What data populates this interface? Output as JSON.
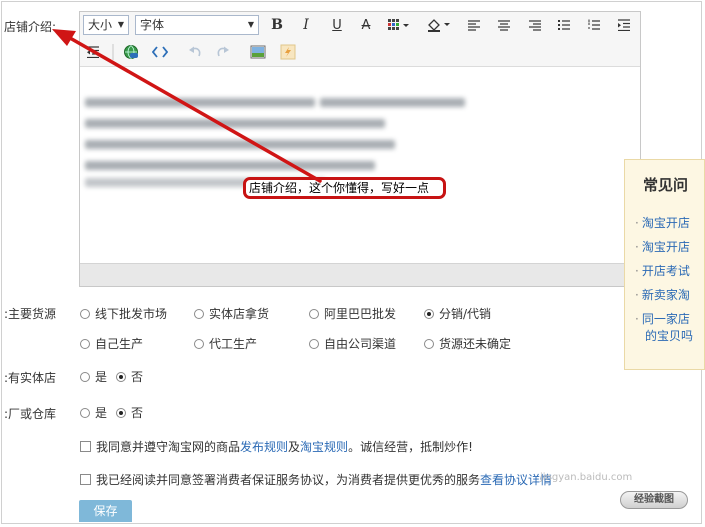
{
  "labels": {
    "shop_intro": "店铺介绍:",
    "main_source": "主要货源:",
    "has_store": "有实体店:",
    "has_warehouse": "厂或仓库:"
  },
  "toolbar": {
    "size_select": "大小",
    "font_select": "字体",
    "bold": "B",
    "italic": "I",
    "underline": "U",
    "strike": "A"
  },
  "callout": "店铺介绍，这个你懂得，写好一点",
  "faq": {
    "title": "常见问",
    "items": [
      "淘宝开店",
      "淘宝开店",
      "开店考试",
      "新卖家淘",
      "同一家店",
      "的宝贝吗"
    ]
  },
  "source_options": [
    [
      "线下批发市场",
      "实体店拿货",
      "阿里巴巴批发",
      "分销/代销"
    ],
    [
      "自己生产",
      "代工生产",
      "自由公司渠道",
      "货源还未确定"
    ]
  ],
  "source_selected": "分销/代销",
  "yes_no": {
    "yes": "是",
    "no": "否"
  },
  "agree1": {
    "pre": "我同意并遵守淘宝网的商品",
    "link1": "发布规则",
    "mid": " 及",
    "link2": "淘宝规则",
    "post": "。诚信经营，抵制炒作!"
  },
  "agree2": {
    "pre": "我已经阅读并同意签署消费者保证服务协议，为消费者提供更优秀的服务",
    "link": "查看协议详情"
  },
  "save_label": "保存",
  "watermark": "jingyan.baidu.com",
  "watermark_button": "经验截图",
  "colors": {
    "arrow": "#d01515",
    "link": "#2b6ab5",
    "save": "#7fb8d9"
  }
}
